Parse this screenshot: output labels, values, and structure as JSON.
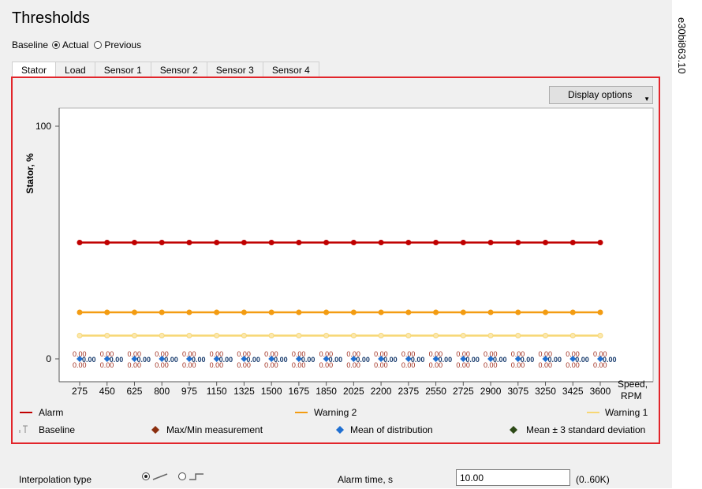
{
  "page": {
    "title": "Thresholds",
    "baseline_label": "Baseline",
    "baseline_options": [
      {
        "label": "Actual",
        "checked": true
      },
      {
        "label": "Previous",
        "checked": false
      }
    ],
    "tabs": [
      "Stator",
      "Load",
      "Sensor 1",
      "Sensor 2",
      "Sensor 3",
      "Sensor 4"
    ],
    "active_tab": "Stator",
    "display_options_label": "Display options",
    "side_note": "e30bi863.10"
  },
  "chart_data": {
    "type": "line",
    "ylabel": "Stator, %",
    "xlabel": "Speed, RPM",
    "x": [
      275,
      450,
      625,
      800,
      975,
      1150,
      1325,
      1500,
      1675,
      1850,
      2025,
      2200,
      2375,
      2550,
      2725,
      2900,
      3075,
      3250,
      3425,
      3600
    ],
    "y_ticks": [
      0,
      100
    ],
    "ylim": [
      0,
      100
    ],
    "series": [
      {
        "name": "Alarm",
        "color": "#c00000",
        "value": 50
      },
      {
        "name": "Warning 2",
        "color": "#f39c12",
        "value": 20
      },
      {
        "name": "Warning 1",
        "color": "#f7d774",
        "value": 10
      }
    ],
    "point_labels": {
      "max": "0.00",
      "min": "0.00",
      "mean": "0.00"
    },
    "legend": [
      {
        "name": "Alarm",
        "symbol": "line",
        "color": "#c00000"
      },
      {
        "name": "Warning 2",
        "symbol": "line",
        "color": "#f39c12"
      },
      {
        "name": "Warning 1",
        "symbol": "line",
        "color": "#f7d774"
      },
      {
        "name": "Baseline",
        "symbol": "baseline",
        "color": "#888888"
      },
      {
        "name": "Max/Min measurement",
        "symbol": "diamond",
        "color": "#8b2e0e"
      },
      {
        "name": "Mean of distribution",
        "symbol": "diamond",
        "color": "#1f6fd1"
      },
      {
        "name": "Mean ± 3 standard deviation",
        "symbol": "diamond",
        "color": "#2d4a17"
      }
    ],
    "legend_placement": "bottom"
  },
  "bottom": {
    "interpolation_label": "Interpolation type",
    "interpolation_options": [
      {
        "icon": "linear-interpolation-icon",
        "checked": true
      },
      {
        "icon": "step-interpolation-icon",
        "checked": false
      }
    ],
    "alarm_time_label": "Alarm time, s",
    "alarm_time_value": "10.00",
    "alarm_time_range": "(0..60K)"
  }
}
